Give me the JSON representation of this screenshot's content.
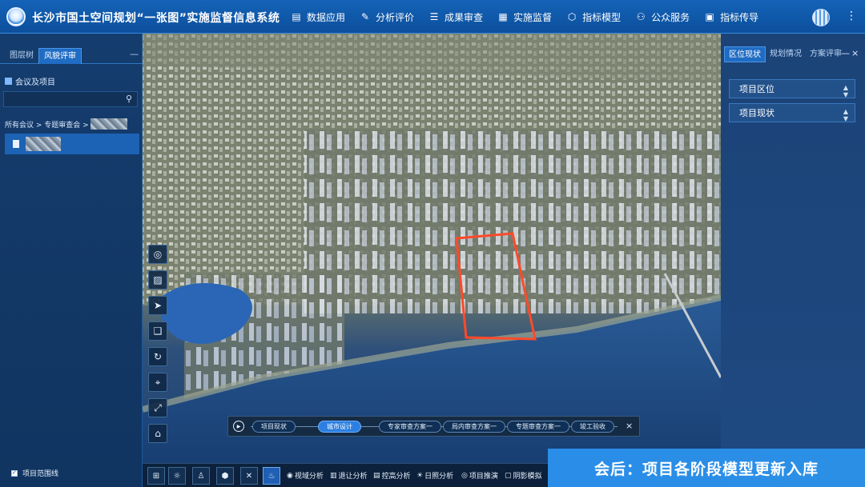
{
  "header": {
    "title": "长沙市国土空间规划“一张图”实施监督信息系统",
    "nav": [
      {
        "label": "数据应用",
        "icon": "database-icon"
      },
      {
        "label": "分析评价",
        "icon": "analysis-icon"
      },
      {
        "label": "成果审查",
        "icon": "review-icon"
      },
      {
        "label": "实施监督",
        "icon": "supervision-icon"
      },
      {
        "label": "指标模型",
        "icon": "model-icon"
      },
      {
        "label": "公众服务",
        "icon": "public-service-icon"
      },
      {
        "label": "指标传导",
        "icon": "transmission-icon"
      }
    ],
    "more": "⋮"
  },
  "left_panel": {
    "tabs": [
      "图层树",
      "风貌评审"
    ],
    "active_tab": "风貌评审",
    "collapse": "—",
    "section_title": "会议及项目",
    "search_placeholder": "",
    "breadcrumb": "所有会议 > 专题审查会 >",
    "range_label": "项目范围线"
  },
  "right_panel": {
    "tabs": [
      "区位现状",
      "规划情况",
      "方案评审"
    ],
    "active_tab": "区位现状",
    "minimize": "—",
    "close": "×",
    "sections": [
      "项目区位",
      "项目现状"
    ]
  },
  "timeline": {
    "stages": [
      "项目现状",
      "城市设计",
      "专家审查方案一",
      "局内审查方案一",
      "专题审查方案一",
      "竣工验收"
    ],
    "active_stage": "城市设计",
    "close": "×"
  },
  "bottom_bar": {
    "functions": [
      "视域分析",
      "退让分析",
      "控高分析",
      "日照分析",
      "项目推演",
      "阴影模拟"
    ]
  },
  "caption": "会后：项目各阶段模型更新入库",
  "colors": {
    "accent": "#2c7fe0",
    "header": "#1463b8",
    "highlight": "#ff4a2a"
  }
}
